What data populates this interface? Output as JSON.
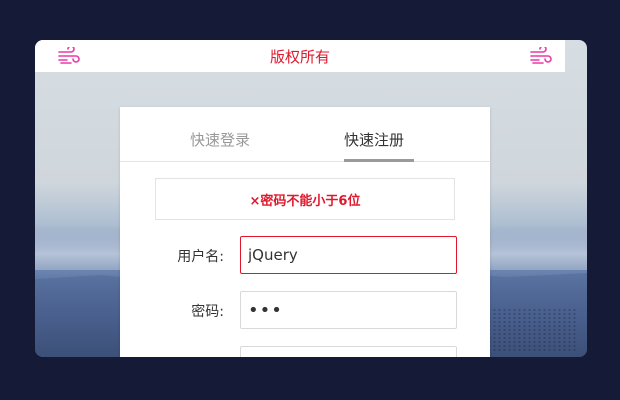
{
  "header": {
    "title": "版权所有",
    "left_icon": "wind-icon",
    "right_icon": "wind-icon",
    "accent_color": "#e0182d"
  },
  "tabs": [
    {
      "label": "快速登录",
      "active": false
    },
    {
      "label": "快速注册",
      "active": true
    }
  ],
  "error": {
    "message": "×密码不能小于6位"
  },
  "form": {
    "username": {
      "label": "用户名:",
      "value": "jQuery"
    },
    "password": {
      "label": "密码:",
      "value": "•••"
    },
    "confirm": {
      "label": "",
      "value": ""
    }
  }
}
